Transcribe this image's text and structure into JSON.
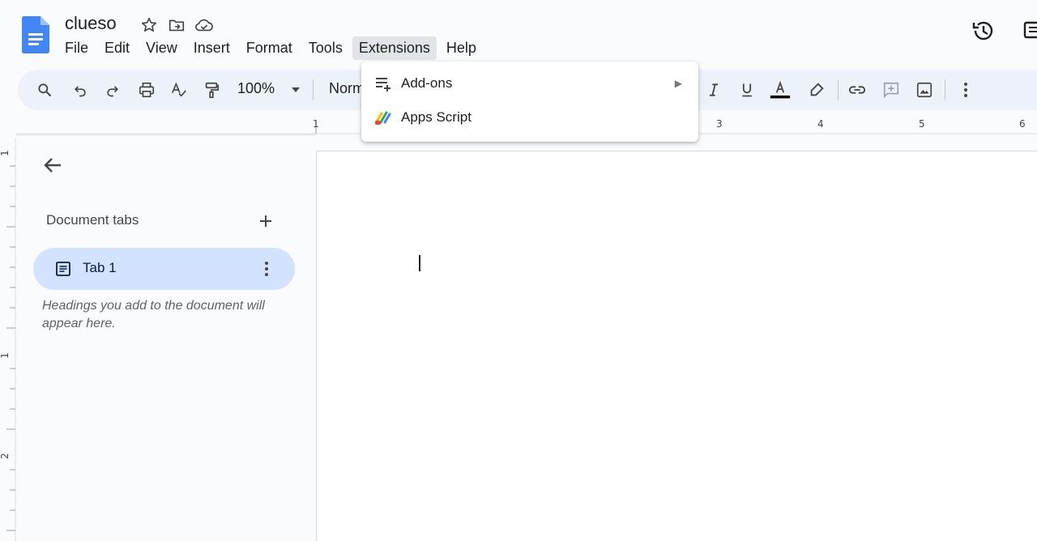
{
  "doc": {
    "title": "clueso"
  },
  "menubar": [
    "File",
    "Edit",
    "View",
    "Insert",
    "Format",
    "Tools",
    "Extensions",
    "Help"
  ],
  "toolbar": {
    "zoom": "100%",
    "style": "Normal text"
  },
  "ruler": {
    "h": [
      "1",
      "3",
      "4",
      "5",
      "6"
    ],
    "v": [
      "1",
      "1",
      "2"
    ]
  },
  "sidebar": {
    "heading": "Document tabs",
    "tab_label": "Tab 1",
    "hint": "Headings you add to the document will appear here."
  },
  "extensions_menu": {
    "items": [
      {
        "label": "Add-ons",
        "icon": "addons-icon",
        "has_submenu": true
      },
      {
        "label": "Apps Script",
        "icon": "apps-script-icon",
        "has_submenu": false
      }
    ]
  },
  "colors": {
    "accent": "#1a73e8",
    "toolbar_bg": "#edf2fa",
    "tab_active": "#d3e3fd"
  }
}
